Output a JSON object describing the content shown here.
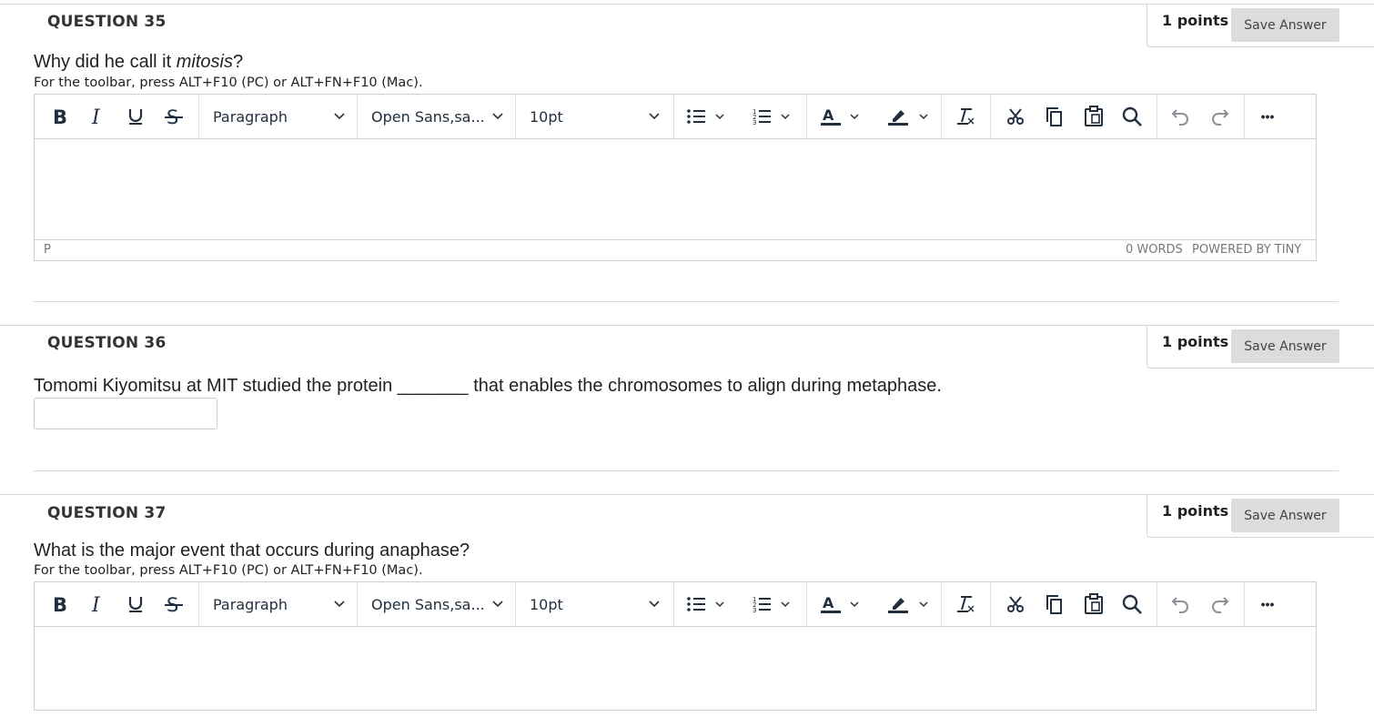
{
  "toolbar_labels": {
    "paragraph": "Paragraph",
    "font": "Open Sans,sa...",
    "size": "10pt",
    "more": "•••"
  },
  "editor_status": {
    "path": "P",
    "words": "0 WORDS",
    "powered": "POWERED BY TINY"
  },
  "toolbar_hint": "For the toolbar, press ALT+F10 (PC) or ALT+FN+F10 (Mac).",
  "save_label": "Save Answer",
  "points_label": "1 points",
  "questions": [
    {
      "title": "QUESTION 35",
      "text_before": "Why did he call it ",
      "text_italic": "mitosis",
      "text_after": "?"
    },
    {
      "title": "QUESTION 36",
      "text": "Tomomi Kiyomitsu at MIT studied the protein _______ that enables the chromosomes to align during metaphase.",
      "input_value": ""
    },
    {
      "title": "QUESTION 37",
      "text": "What is the major event that occurs during anaphase?"
    }
  ],
  "colors": {
    "accent_text": "#222f3e",
    "button_bg": "#dcdcdc",
    "border": "#cfcfcf"
  }
}
